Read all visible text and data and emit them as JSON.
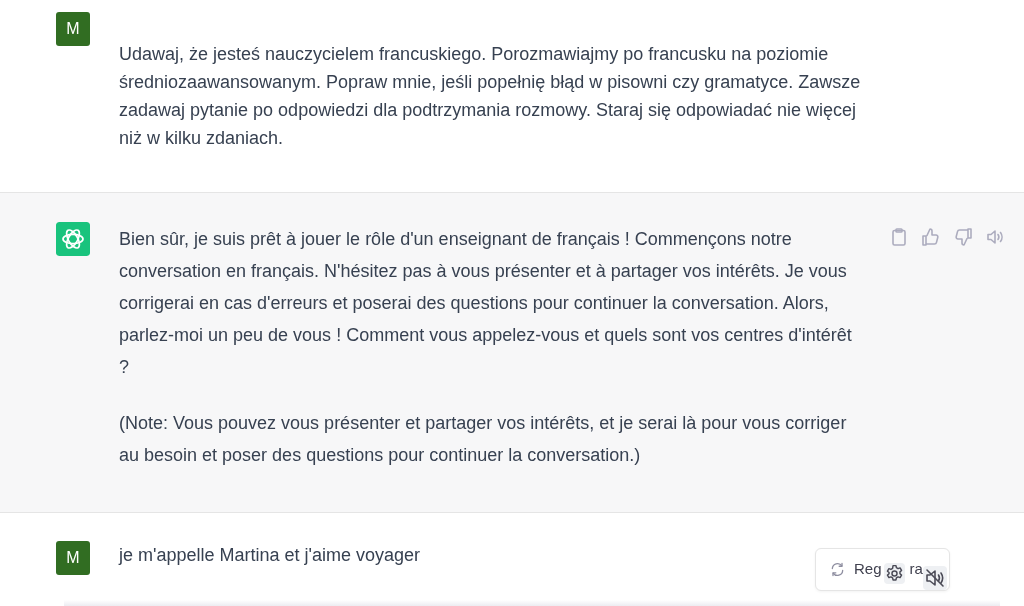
{
  "messages": [
    {
      "kind": "user",
      "avatar": "M",
      "paragraphs": [
        "Udawaj, że jesteś nauczycielem francuskiego. Porozmawiajmy po francusku na poziomie średniozaawansowanym. Popraw mnie, jeśli popełnię błąd w pisowni czy gramatyce. Zawsze zadawaj pytanie po odpowiedzi dla podtrzymania rozmowy. Staraj się odpowiadać nie więcej niż w kilku zdaniach."
      ]
    },
    {
      "kind": "assistant",
      "paragraphs": [
        "Bien sûr, je suis prêt à jouer le rôle d'un enseignant de français ! Commençons notre conversation en français. N'hésitez pas à vous présenter et à partager vos intérêts. Je vous corrigerai en cas d'erreurs et poserai des questions pour continuer la conversation. Alors, parlez-moi un peu de vous ! Comment vous appelez-vous et quels sont vos centres d'intérêt ?",
        "(Note: Vous pouvez vous présenter et partager vos intérêts, et je serai là pour vous corriger au besoin et poser des questions pour continuer la conversation.)"
      ]
    },
    {
      "kind": "user",
      "avatar": "M",
      "paragraphs": [
        "je m'appelle Martina et j'aime voyager"
      ]
    }
  ],
  "regenerate_button": {
    "label_parts": [
      "Reg",
      "ra"
    ]
  }
}
